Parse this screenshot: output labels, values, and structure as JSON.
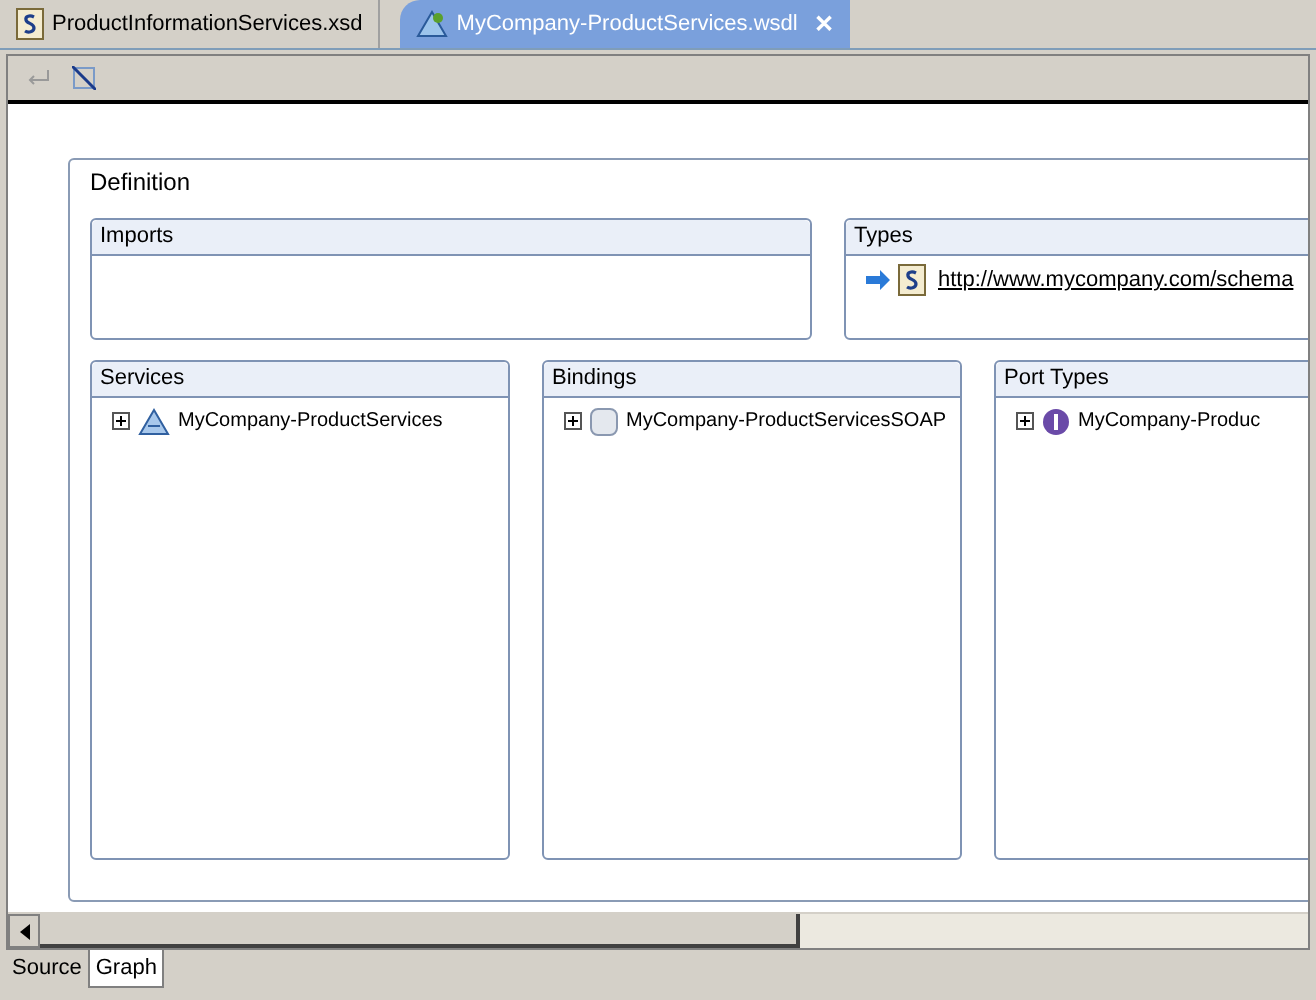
{
  "editor_tabs": [
    {
      "label": "ProductInformationServices.xsd",
      "kind": "xsd",
      "selected": false,
      "closable": false
    },
    {
      "label": "MyCompany-ProductServices.wsdl",
      "kind": "wsdl",
      "selected": true,
      "closable": true
    }
  ],
  "close_glyph": "✕",
  "definition": {
    "title": "Definition",
    "imports": {
      "title": "Imports"
    },
    "types": {
      "title": "Types",
      "items": [
        {
          "label": "http://www.mycompany.com/schema"
        }
      ]
    },
    "columns": [
      {
        "title": "Services",
        "items": [
          {
            "label": "MyCompany-ProductServices",
            "kind": "service"
          }
        ]
      },
      {
        "title": "Bindings",
        "items": [
          {
            "label": "MyCompany-ProductServicesSOAP",
            "kind": "binding"
          }
        ]
      },
      {
        "title": "Port Types",
        "items": [
          {
            "label": "MyCompany-Produc",
            "kind": "porttype"
          }
        ]
      }
    ]
  },
  "bottom_tabs": [
    {
      "label": "Source",
      "selected": false
    },
    {
      "label": "Graph",
      "selected": true
    }
  ]
}
